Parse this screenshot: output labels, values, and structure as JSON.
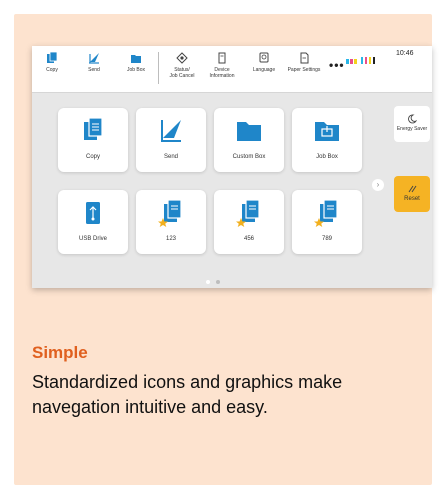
{
  "toolbar": {
    "items": [
      {
        "label": "Copy",
        "icon": "copy-icon"
      },
      {
        "label": "Send",
        "icon": "send-icon"
      },
      {
        "label": "Job Box",
        "icon": "job-box-icon"
      },
      {
        "label": "Status/\nJob Cancel",
        "icon": "status-icon"
      },
      {
        "label": "Device\nInformation",
        "icon": "device-info-icon"
      },
      {
        "label": "Language",
        "icon": "language-icon"
      },
      {
        "label": "Paper Settings",
        "icon": "paper-settings-icon"
      }
    ],
    "more": "•••",
    "time": "10:46"
  },
  "tiles": [
    {
      "label": "Copy",
      "icon": "copy-icon"
    },
    {
      "label": "Send",
      "icon": "send-icon"
    },
    {
      "label": "Custom Box",
      "icon": "folder-icon"
    },
    {
      "label": "Job Box",
      "icon": "job-box-icon"
    },
    {
      "label": "USB Drive",
      "icon": "usb-drive-icon"
    },
    {
      "label": "123",
      "icon": "favorite-document-icon"
    },
    {
      "label": "456",
      "icon": "favorite-document-icon"
    },
    {
      "label": "789",
      "icon": "favorite-document-icon"
    }
  ],
  "side": {
    "energy_saver": "Energy Saver",
    "reset": "Reset"
  },
  "colors": {
    "card_bg": "#fde3cf",
    "accent_orange": "#e0601f",
    "icon_blue": "#1f86c9",
    "reset_yellow": "#f5b324"
  },
  "caption": {
    "title": "Simple",
    "body": "Standardized icons and graphics make navegation intuitive and easy."
  }
}
